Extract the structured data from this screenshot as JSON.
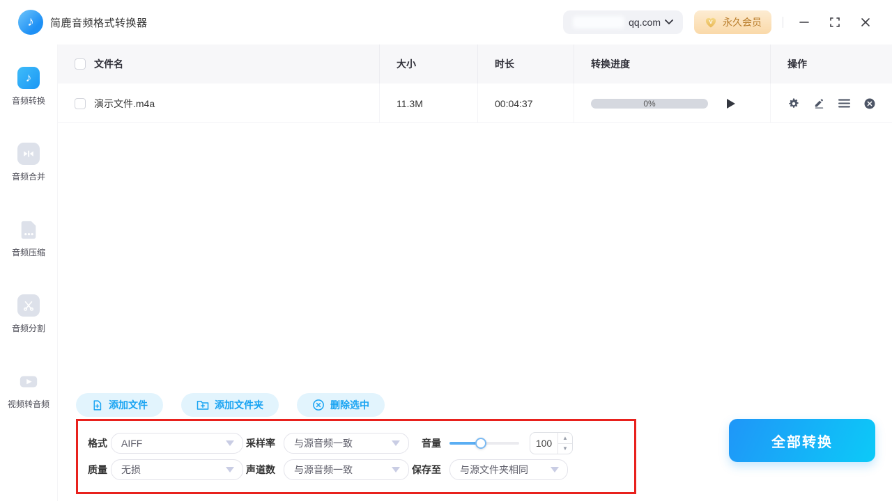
{
  "app": {
    "title": "简鹿音频格式转换器"
  },
  "header": {
    "account": {
      "domain": "qq.com"
    },
    "vip_badge": "永久会员"
  },
  "sidebar": {
    "items": [
      {
        "label": "音频转换",
        "icon": "music-note-icon",
        "active": true
      },
      {
        "label": "音频合并",
        "icon": "merge-icon",
        "active": false
      },
      {
        "label": "音频压缩",
        "icon": "compress-file-icon",
        "active": false
      },
      {
        "label": "音频分割",
        "icon": "scissors-icon",
        "active": false
      },
      {
        "label": "视频转音频",
        "icon": "video-camera-icon",
        "active": false
      }
    ]
  },
  "table": {
    "columns": [
      "文件名",
      "大小",
      "时长",
      "转换进度",
      "操作"
    ],
    "rows": [
      {
        "name": "演示文件.m4a",
        "size": "11.3M",
        "duration": "00:04:37",
        "progress": "0%",
        "progress_value": 0
      }
    ]
  },
  "toolbar": {
    "add_file": "添加文件",
    "add_folder": "添加文件夹",
    "delete_selected": "删除选中"
  },
  "settings": {
    "format": {
      "label": "格式",
      "value": "AIFF"
    },
    "sample_rate": {
      "label": "采样率",
      "value": "与源音频一致"
    },
    "volume": {
      "label": "音量",
      "value": "100",
      "slider_percent": 45
    },
    "quality": {
      "label": "质量",
      "value": "无损"
    },
    "channels": {
      "label": "声道数",
      "value": "与源音频一致"
    },
    "save_to": {
      "label": "保存至",
      "value": "与源文件夹相同"
    }
  },
  "convert_all_label": "全部转换",
  "colors": {
    "accent_blue": "#18a3f2",
    "convert_gradient_start": "#1f96f8",
    "convert_gradient_end": "#0ccaf8",
    "highlight_red": "#e8211d",
    "vip_text": "#b87b28",
    "progress_track": "#d5d8df"
  }
}
